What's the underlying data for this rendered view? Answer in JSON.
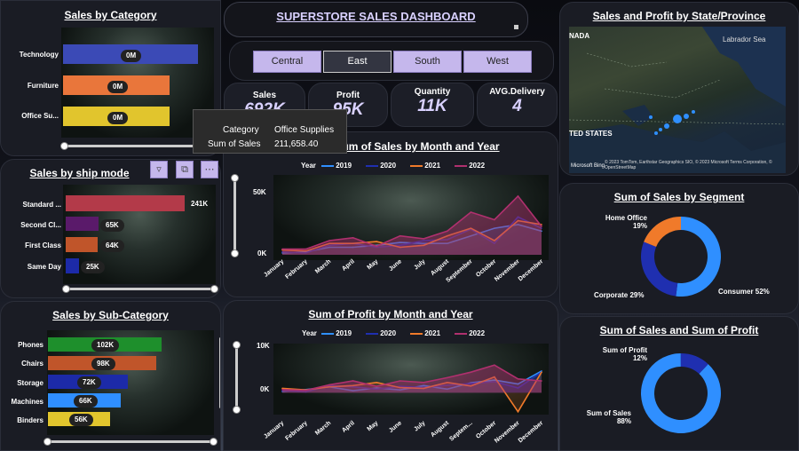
{
  "dashboard": {
    "title": "SUPERSTORE SALES DASHBOARD"
  },
  "regions": [
    {
      "label": "Central"
    },
    {
      "label": "East"
    },
    {
      "label": "South"
    },
    {
      "label": "West"
    }
  ],
  "kpis": [
    {
      "label": "Sales",
      "value": "692K"
    },
    {
      "label": "Profit",
      "value": "95K"
    },
    {
      "label": "Quantity",
      "value": "11K"
    },
    {
      "label": "AVG.Delivery",
      "value": "4"
    }
  ],
  "sales_by_category": {
    "title": "Sales by Category",
    "items": [
      {
        "label": "Technology",
        "badge": "0M"
      },
      {
        "label": "Furniture",
        "badge": "0M"
      },
      {
        "label": "Office Su...",
        "badge": "0M"
      }
    ]
  },
  "tooltip": {
    "key1": "Category",
    "val1": "Office Supplies",
    "key2": "Sum of Sales",
    "val2": "211,658.40"
  },
  "sales_by_ship": {
    "title": "Sales by ship mode",
    "items": [
      {
        "label": "Standard ...",
        "value": "241K"
      },
      {
        "label": "Second Cl...",
        "value": "65K"
      },
      {
        "label": "First Class",
        "value": "64K"
      },
      {
        "label": "Same Day",
        "value": "25K"
      }
    ]
  },
  "sales_by_subcat": {
    "title": "Sales by Sub-Category",
    "items": [
      {
        "label": "Phones",
        "value": "102K"
      },
      {
        "label": "Chairs",
        "value": "98K"
      },
      {
        "label": "Storage",
        "value": "72K"
      },
      {
        "label": "Machines",
        "value": "66K"
      },
      {
        "label": "Binders",
        "value": "56K"
      }
    ]
  },
  "map": {
    "title": "Sales and Profit by State/Province",
    "label_canada": "NADA",
    "label_sea": "Labrador Sea",
    "label_states": "TED STATES",
    "attribution": "© 2023 TomTom, Earthstar Geographics SIO, © 2023 Microsoft Terms Corporation, © OpenStreetMap",
    "brand": "Microsoft Bing"
  },
  "sales_month": {
    "title": "Sum of Sales by Month and Year",
    "yticks": [
      "50K",
      "0K"
    ]
  },
  "profit_month": {
    "title": "Sum of Profit by Month and Year",
    "yticks": [
      "10K",
      "0K"
    ]
  },
  "legend": {
    "label": "Year",
    "years": [
      "2019",
      "2020",
      "2021",
      "2022"
    ]
  },
  "months": [
    "January",
    "February",
    "March",
    "April",
    "May",
    "June",
    "July",
    "August",
    "September",
    "October",
    "November",
    "December"
  ],
  "profit_months": [
    "January",
    "February",
    "March",
    "April",
    "May",
    "June",
    "July",
    "August",
    "Septem...",
    "October",
    "November",
    "December"
  ],
  "segment": {
    "title": "Sum of Sales by Segment",
    "labels": [
      {
        "name": "Home Office",
        "pct": "19%"
      },
      {
        "name": "Corporate 29%"
      },
      {
        "name": "Consumer 52%"
      }
    ]
  },
  "sales_profit": {
    "title": "Sum of Sales and Sum of Profit",
    "labels": [
      {
        "name": "Sum of Profit",
        "pct": "12%"
      },
      {
        "name": "Sum of Sales",
        "pct": "88%"
      }
    ]
  },
  "colors": {
    "y2019": "#2f8fff",
    "y2020": "#1f2fb0",
    "y2021": "#f07a2a",
    "y2022": "#b0306e",
    "accent": "#c5b7ec"
  },
  "chart_data": [
    {
      "type": "bar",
      "title": "Sales by ship mode",
      "categories": [
        "Standard ...",
        "Second Cl...",
        "First Class",
        "Same Day"
      ],
      "values": [
        241,
        65,
        64,
        25
      ],
      "unit": "K"
    },
    {
      "type": "bar",
      "title": "Sales by Sub-Category",
      "categories": [
        "Phones",
        "Chairs",
        "Storage",
        "Machines",
        "Binders"
      ],
      "values": [
        102,
        98,
        72,
        66,
        56
      ],
      "unit": "K"
    },
    {
      "type": "pie",
      "title": "Sum of Sales by Segment",
      "categories": [
        "Consumer",
        "Corporate",
        "Home Office"
      ],
      "values": [
        52,
        29,
        19
      ]
    },
    {
      "type": "pie",
      "title": "Sum of Sales and Sum of Profit",
      "categories": [
        "Sum of Sales",
        "Sum of Profit"
      ],
      "values": [
        88,
        12
      ]
    },
    {
      "type": "area",
      "title": "Sum of Sales by Month and Year",
      "ylim": [
        0,
        75000
      ],
      "categories": [
        "January",
        "February",
        "March",
        "April",
        "May",
        "June",
        "July",
        "August",
        "September",
        "October",
        "November",
        "December"
      ],
      "series": [
        {
          "name": "2019",
          "values": [
            2000,
            3000,
            8000,
            8000,
            10000,
            13000,
            12000,
            12000,
            20000,
            28000,
            32000,
            25000
          ]
        },
        {
          "name": "2020",
          "values": [
            3000,
            2000,
            10000,
            12000,
            8000,
            10000,
            15000,
            16000,
            27000,
            12000,
            40000,
            28000
          ]
        },
        {
          "name": "2021",
          "values": [
            5000,
            4000,
            12000,
            12000,
            14000,
            8000,
            10000,
            20000,
            28000,
            15000,
            36000,
            32000
          ]
        },
        {
          "name": "2022",
          "values": [
            6000,
            6000,
            15000,
            18000,
            9000,
            20000,
            17000,
            25000,
            45000,
            37000,
            62000,
            30000
          ]
        }
      ]
    },
    {
      "type": "area",
      "title": "Sum of Profit by Month and Year",
      "ylim": [
        -6000,
        12000
      ],
      "categories": [
        "January",
        "February",
        "March",
        "April",
        "May",
        "June",
        "July",
        "August",
        "Septem...",
        "October",
        "November",
        "December"
      ],
      "series": [
        {
          "name": "2019",
          "values": [
            300,
            800,
            1500,
            500,
            1200,
            700,
            1800,
            900,
            2500,
            3200,
            2200,
            5500
          ]
        },
        {
          "name": "2020",
          "values": [
            500,
            200,
            1800,
            1500,
            900,
            1600,
            1300,
            1900,
            2300,
            2800,
            1200,
            5200
          ]
        },
        {
          "name": "2021",
          "values": [
            1100,
            700,
            1500,
            1800,
            2600,
            1300,
            1100,
            2600,
            1700,
            4000,
            -4800,
            5200
          ]
        },
        {
          "name": "2022",
          "values": [
            800,
            600,
            2000,
            3000,
            1600,
            3000,
            2600,
            3800,
            5200,
            7000,
            3500,
            3000
          ]
        }
      ]
    }
  ]
}
